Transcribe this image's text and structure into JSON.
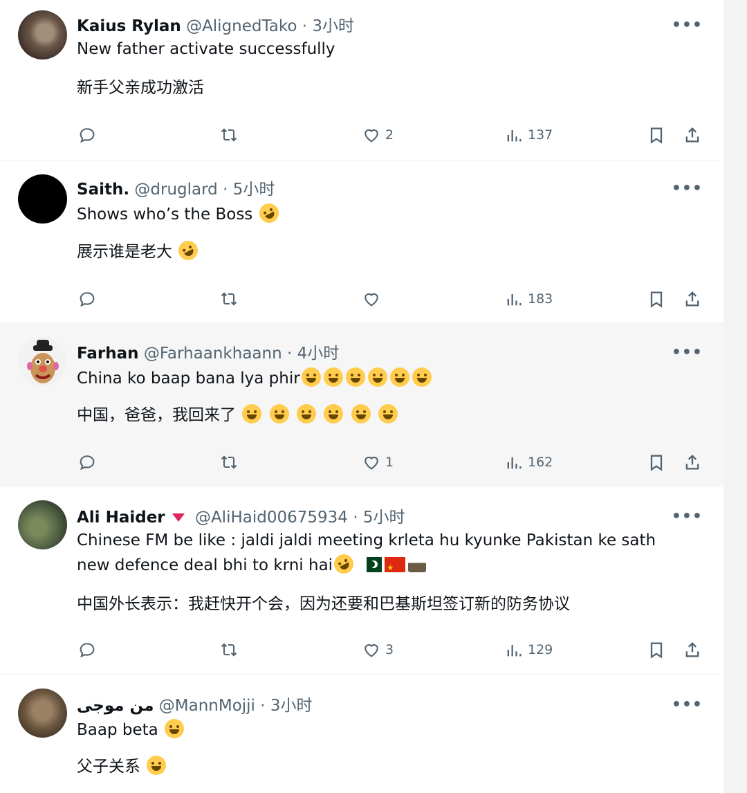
{
  "posts": [
    {
      "name": "Kaius Rylan",
      "handle": "@AlignedTako",
      "time": "· 3小时",
      "text_en": "New father activate successfully",
      "text_zh": "新手父亲成功激活",
      "likes": "2",
      "views": "137"
    },
    {
      "name": "Saith.",
      "handle": "@druglard",
      "time": "· 5小时",
      "text_en": "Shows who’s the Boss",
      "text_zh": "展示谁是老大",
      "likes": "",
      "views": "183"
    },
    {
      "name": "Farhan",
      "handle": "@Farhaankhaann",
      "time": "· 4小时",
      "text_en": "China ko baap bana lya phir",
      "text_zh": "中国，爸爸，我回来了",
      "likes": "1",
      "views": "162"
    },
    {
      "name": "Ali Haider",
      "handle": "@AliHaid00675934",
      "time": "· 5小时",
      "text_en": "Chinese FM be like : jaldi jaldi meeting krleta hu kyunke Pakistan ke sath new defence deal bhi to krni hai",
      "text_zh": "中国外长表示：我赶快开个会，因为还要和巴基斯坦签订新的防务协议",
      "likes": "3",
      "views": "129"
    },
    {
      "name": "من موجی",
      "handle": "@MannMojji",
      "time": "· 3小时",
      "text_en": "Baap beta",
      "text_zh": "父子关系"
    }
  ],
  "more_label": "•••",
  "icons": {
    "reply": "reply-icon",
    "repost": "repost-icon",
    "like": "like-icon",
    "views": "views-icon",
    "bookmark": "bookmark-icon",
    "share": "share-icon"
  },
  "colors": {
    "muted": "#536471",
    "highlight_bg": "#f6f6f6",
    "verified_badge": "#e0245e"
  }
}
